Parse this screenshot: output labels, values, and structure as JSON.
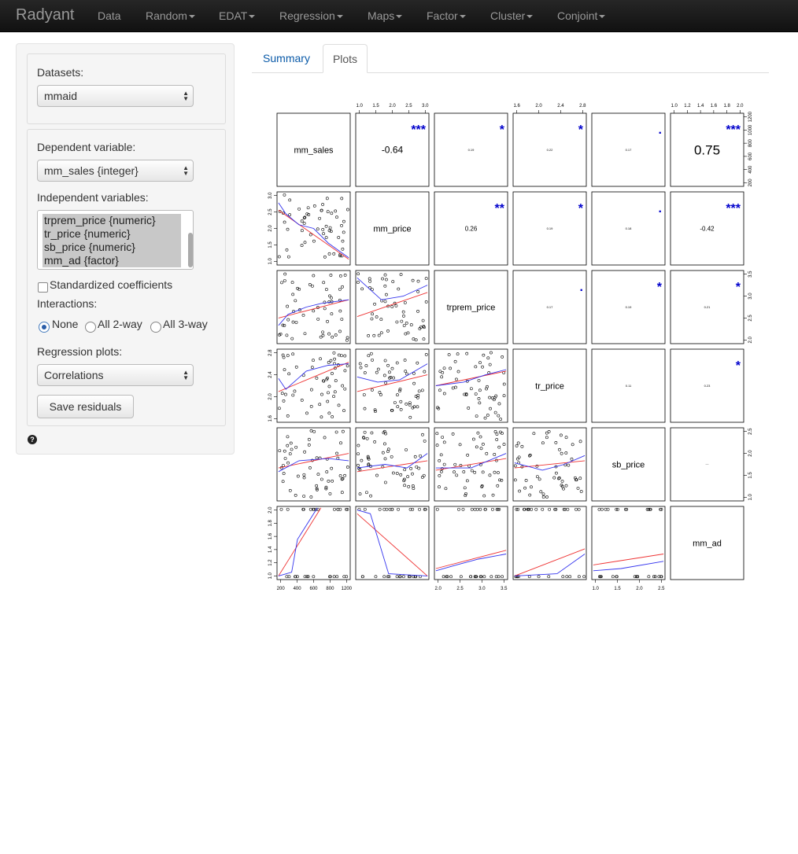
{
  "navbar": {
    "brand": "Radyant",
    "items": [
      {
        "label": "Data",
        "dropdown": false
      },
      {
        "label": "Random",
        "dropdown": true
      },
      {
        "label": "EDAT",
        "dropdown": true
      },
      {
        "label": "Regression",
        "dropdown": true
      },
      {
        "label": "Maps",
        "dropdown": true
      },
      {
        "label": "Factor",
        "dropdown": true
      },
      {
        "label": "Cluster",
        "dropdown": true
      },
      {
        "label": "Conjoint",
        "dropdown": true
      }
    ]
  },
  "sidebar": {
    "datasets_label": "Datasets:",
    "dataset_value": "mmaid",
    "dependent_label": "Dependent variable:",
    "dependent_value": "mm_sales {integer}",
    "independent_label": "Independent variables:",
    "independent_options": [
      "trprem_price {numeric}",
      "tr_price {numeric}",
      "sb_price {numeric}",
      "mm_ad {factor}"
    ],
    "standardized_label": "Standardized coefficients",
    "standardized_checked": false,
    "interactions_label": "Interactions:",
    "interaction_options": [
      {
        "label": "None",
        "selected": true
      },
      {
        "label": "All 2-way",
        "selected": false
      },
      {
        "label": "All 3-way",
        "selected": false
      }
    ],
    "regplots_label": "Regression plots:",
    "regplots_value": "Correlations",
    "save_button": "Save residuals",
    "help_icon": "question-circle-icon"
  },
  "tabs": [
    {
      "label": "Summary",
      "active": false
    },
    {
      "label": "Plots",
      "active": true
    }
  ],
  "colors": {
    "accent": "#0a5aa8",
    "stars": "#0000cc",
    "fit_line": "#ee3333",
    "smooth_line": "#3333ee"
  },
  "chart_data": {
    "type": "scatter",
    "variables": [
      "mm_sales",
      "mm_price",
      "trprem_price",
      "tr_price",
      "sb_price",
      "mm_ad"
    ],
    "correlations": [
      {
        "row": 0,
        "col": 1,
        "r": "-0.64",
        "stars": "***",
        "emph": "large"
      },
      {
        "row": 0,
        "col": 2,
        "r": "0.19",
        "stars": "*",
        "emph": "tiny"
      },
      {
        "row": 0,
        "col": 3,
        "r": "0.22",
        "stars": "*",
        "emph": "tiny"
      },
      {
        "row": 0,
        "col": 4,
        "r": "0.17",
        "stars": ".",
        "emph": "tiny"
      },
      {
        "row": 0,
        "col": 5,
        "r": "0.75",
        "stars": "***",
        "emph": "xlarge"
      },
      {
        "row": 1,
        "col": 2,
        "r": "0.26",
        "stars": "**",
        "emph": "small"
      },
      {
        "row": 1,
        "col": 3,
        "r": "0.19",
        "stars": "*",
        "emph": "tiny"
      },
      {
        "row": 1,
        "col": 4,
        "r": "0.18",
        "stars": ".",
        "emph": "tiny"
      },
      {
        "row": 1,
        "col": 5,
        "r": "-0.42",
        "stars": "***",
        "emph": "small"
      },
      {
        "row": 2,
        "col": 3,
        "r": "0.17",
        "stars": ".",
        "emph": "tiny"
      },
      {
        "row": 2,
        "col": 4,
        "r": "0.19",
        "stars": "*",
        "emph": "tiny"
      },
      {
        "row": 2,
        "col": 5,
        "r": "0.21",
        "stars": "*",
        "emph": "tiny"
      },
      {
        "row": 3,
        "col": 4,
        "r": "0.11",
        "stars": "",
        "emph": "tiny"
      },
      {
        "row": 3,
        "col": 5,
        "r": "0.23",
        "stars": "*",
        "emph": "tiny"
      },
      {
        "row": 4,
        "col": 5,
        "r": "",
        "stars": "",
        "emph": "tiny"
      }
    ],
    "axis_ticks": {
      "top": [
        {
          "col": 1,
          "ticks": [
            "1.0",
            "1.5",
            "2.0",
            "2.5",
            "3.0"
          ]
        },
        {
          "col": 3,
          "ticks": [
            "1.6",
            "2.0",
            "2.4",
            "2.8"
          ]
        },
        {
          "col": 5,
          "ticks": [
            "1.0",
            "1.2",
            "1.4",
            "1.6",
            "1.8",
            "2.0"
          ]
        }
      ],
      "bottom": [
        {
          "col": 0,
          "ticks": [
            "200",
            "400",
            "600",
            "800",
            "1200"
          ]
        },
        {
          "col": 2,
          "ticks": [
            "2.0",
            "2.5",
            "3.0",
            "3.5"
          ]
        },
        {
          "col": 4,
          "ticks": [
            "1.0",
            "1.5",
            "2.0",
            "2.5"
          ]
        }
      ],
      "left": [
        {
          "row": 1,
          "ticks": [
            "1.0",
            "1.5",
            "2.0",
            "2.5",
            "3.0"
          ]
        },
        {
          "row": 3,
          "ticks": [
            "1.6",
            "2.0",
            "2.4",
            "2.8"
          ]
        },
        {
          "row": 5,
          "ticks": [
            "1.0",
            "1.2",
            "1.4",
            "1.6",
            "1.8",
            "2.0"
          ]
        }
      ],
      "right": [
        {
          "row": 0,
          "ticks": [
            "200",
            "400",
            "600",
            "800",
            "1000",
            "1200"
          ]
        },
        {
          "row": 2,
          "ticks": [
            "2.0",
            "2.5",
            "3.0",
            "3.5"
          ]
        },
        {
          "row": 4,
          "ticks": [
            "1.0",
            "1.5",
            "2.0",
            "2.5"
          ]
        }
      ]
    }
  }
}
